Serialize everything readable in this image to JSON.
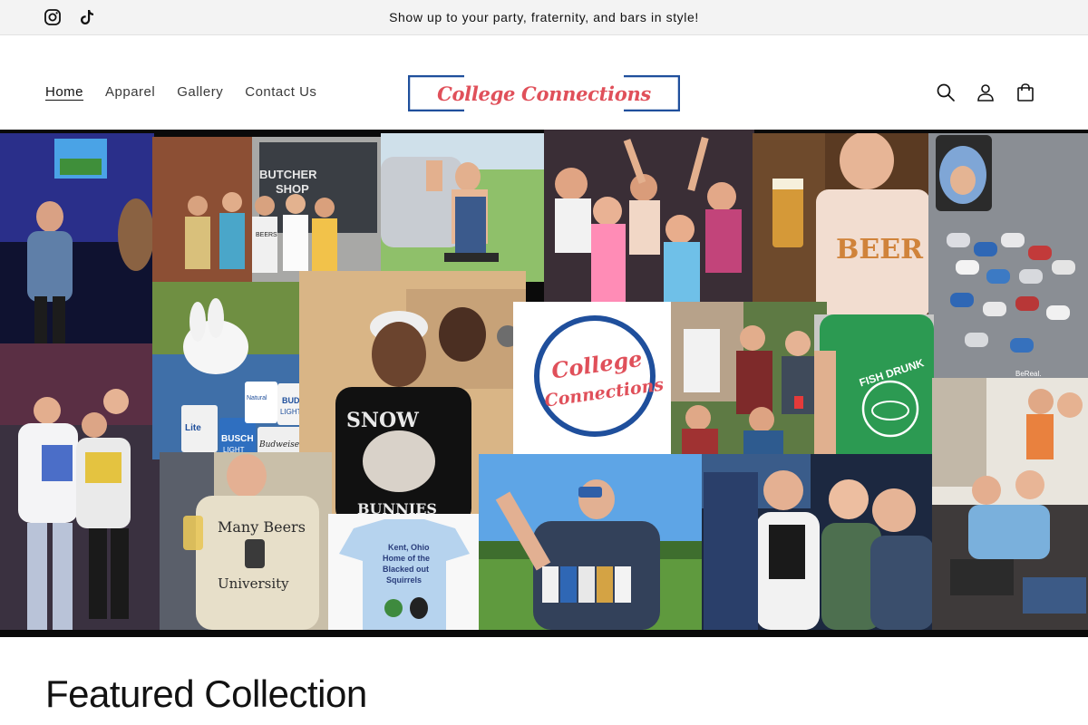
{
  "announcement": {
    "text": "Show up to your party, fraternity, and bars in style!",
    "social": [
      {
        "icon": "instagram-icon"
      },
      {
        "icon": "tiktok-icon"
      }
    ]
  },
  "header": {
    "nav": [
      {
        "label": "Home",
        "active": true
      },
      {
        "label": "Apparel",
        "active": false
      },
      {
        "label": "Gallery",
        "active": false
      },
      {
        "label": "Contact Us",
        "active": false
      }
    ],
    "logo": {
      "text": "College Connections",
      "text_color": "#e0505a",
      "frame_color": "#1f4f9c"
    },
    "icons": [
      "search-icon",
      "account-icon",
      "cart-icon"
    ]
  },
  "hero": {
    "collage_badge": {
      "line1": "College",
      "line2": "Connections"
    },
    "shirts": {
      "beers_top": "BEERS",
      "beer": "BEER",
      "snow": "SNOW",
      "bunnies": "BUNNIES",
      "fish": "FISH DRUNK",
      "many_beers": "Many Beers",
      "university": "University",
      "kent": "Kent, Ohio",
      "home": "Home of the",
      "blacked": "Blacked out",
      "squirrels": "Squirrels"
    },
    "signs": {
      "butcher": "BUTCHER",
      "shop": "SHOP",
      "bereal": "BeReal."
    },
    "cans": {
      "natural": "Natural",
      "bud": "BUD",
      "light": "LIGHT",
      "busch": "BUSCH",
      "lite": "Lite",
      "budweiser": "Budweiser"
    }
  },
  "featured": {
    "title": "Featured Collection"
  },
  "colors": {
    "accent": "#e0505a",
    "brand_blue": "#1f4f9c",
    "announcement_bg": "#f3f3f3"
  }
}
